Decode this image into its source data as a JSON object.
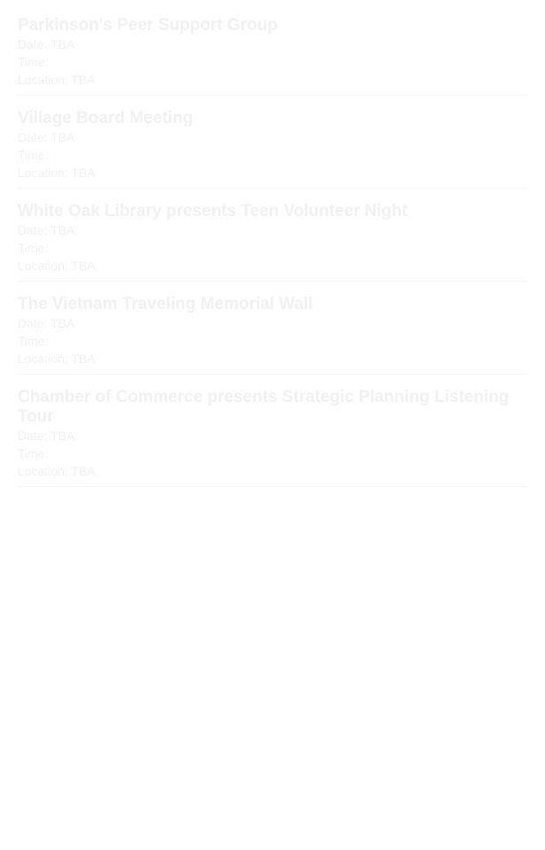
{
  "events": [
    {
      "title": "Parkinson's Peer Support Group",
      "date": "Date: TBA",
      "time": "Time:",
      "location": "Location: TBA"
    },
    {
      "title": "Village Board Meeting",
      "date": "Date: TBA",
      "time": "Time:",
      "location": "Location: TBA"
    },
    {
      "title": "White Oak Library presents Teen Volunteer Night",
      "date": "Date: TBA",
      "time": "Time:",
      "location": "Location: TBA"
    },
    {
      "title": "The Vietnam Traveling Memorial Wall",
      "date": "Date: TBA",
      "time": "Time:",
      "location": "Location: TBA"
    },
    {
      "title": "Chamber of Commerce presents Strategic Planning Listening Tour",
      "date": "Date: TBA",
      "time": "Time:",
      "location": "Location: TBA"
    }
  ]
}
